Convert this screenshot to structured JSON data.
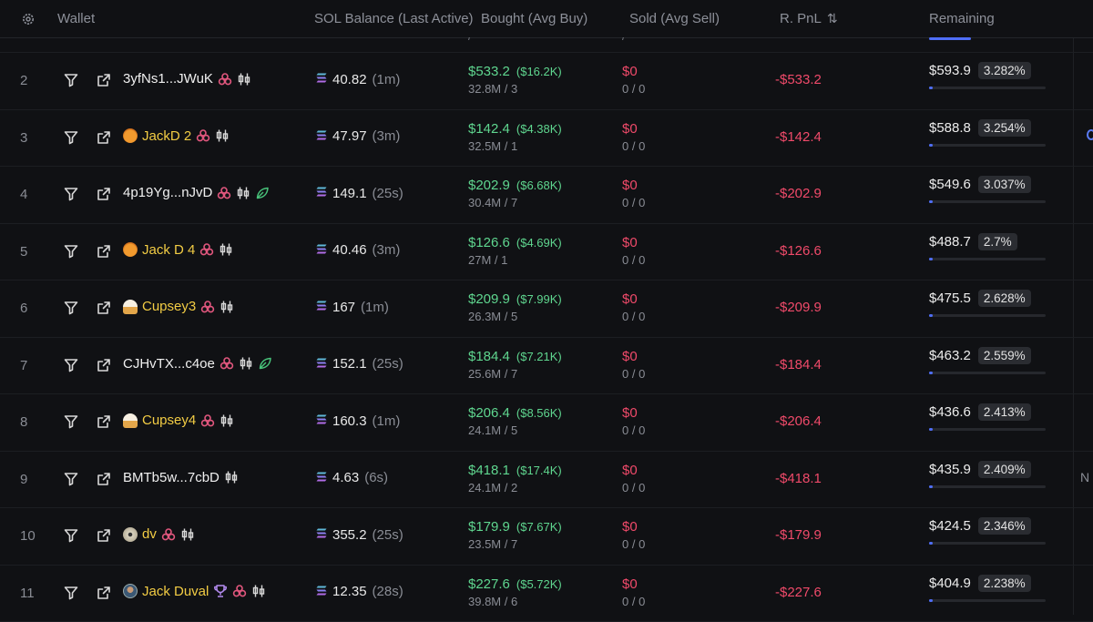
{
  "header": {
    "wallet": "Wallet",
    "sol_balance": "SOL Balance (Last Active)",
    "bought": "Bought (Avg Buy)",
    "sold": "Sold (Avg Sell)",
    "rpnl": "R. PnL",
    "remaining": "Remaining"
  },
  "peek": {
    "bought_sub": "/",
    "sold_sub": "/"
  },
  "colors": {
    "positive": "#5fd68f",
    "negative": "#f04a6a",
    "accent": "#4f6ef7",
    "gold_name": "#f2cc44"
  },
  "rows": [
    {
      "num": "2",
      "wallet": "3yfNs1...JWuK",
      "sol": "40.82",
      "sol_time": "(1m)",
      "bought": "$533.2",
      "bought_avg": "($16.2K)",
      "bought_sub": "32.8M / 3",
      "sold": "$0",
      "sold_sub": "0 / 0",
      "pnl": "-$533.2",
      "remaining": "$593.9",
      "remaining_pct": "3.282%",
      "edge": ""
    },
    {
      "num": "3",
      "wallet": "JackD 2",
      "sol": "47.97",
      "sol_time": "(3m)",
      "bought": "$142.4",
      "bought_avg": "($4.38K)",
      "bought_sub": "32.5M / 1",
      "sold": "$0",
      "sold_sub": "0 / 0",
      "pnl": "-$142.4",
      "remaining": "$588.8",
      "remaining_pct": "3.254%",
      "edge": ""
    },
    {
      "num": "4",
      "wallet": "4p19Yg...nJvD",
      "sol": "149.1",
      "sol_time": "(25s)",
      "bought": "$202.9",
      "bought_avg": "($6.68K)",
      "bought_sub": "30.4M / 7",
      "sold": "$0",
      "sold_sub": "0 / 0",
      "pnl": "-$202.9",
      "remaining": "$549.6",
      "remaining_pct": "3.037%",
      "edge": ""
    },
    {
      "num": "5",
      "wallet": "Jack D 4",
      "sol": "40.46",
      "sol_time": "(3m)",
      "bought": "$126.6",
      "bought_avg": "($4.69K)",
      "bought_sub": "27M / 1",
      "sold": "$0",
      "sold_sub": "0 / 0",
      "pnl": "-$126.6",
      "remaining": "$488.7",
      "remaining_pct": "2.7%",
      "edge": ""
    },
    {
      "num": "6",
      "wallet": "Cupsey3",
      "sol": "167",
      "sol_time": "(1m)",
      "bought": "$209.9",
      "bought_avg": "($7.99K)",
      "bought_sub": "26.3M / 5",
      "sold": "$0",
      "sold_sub": "0 / 0",
      "pnl": "-$209.9",
      "remaining": "$475.5",
      "remaining_pct": "2.628%",
      "edge": ""
    },
    {
      "num": "7",
      "wallet": "CJHvTX...c4oe",
      "sol": "152.1",
      "sol_time": "(25s)",
      "bought": "$184.4",
      "bought_avg": "($7.21K)",
      "bought_sub": "25.6M / 7",
      "sold": "$0",
      "sold_sub": "0 / 0",
      "pnl": "-$184.4",
      "remaining": "$463.2",
      "remaining_pct": "2.559%",
      "edge": ""
    },
    {
      "num": "8",
      "wallet": "Cupsey4",
      "sol": "160.3",
      "sol_time": "(1m)",
      "bought": "$206.4",
      "bought_avg": "($8.56K)",
      "bought_sub": "24.1M / 5",
      "sold": "$0",
      "sold_sub": "0 / 0",
      "pnl": "-$206.4",
      "remaining": "$436.6",
      "remaining_pct": "2.413%",
      "edge": ""
    },
    {
      "num": "9",
      "wallet": "BMTb5w...7cbD",
      "sol": "4.63",
      "sol_time": "(6s)",
      "bought": "$418.1",
      "bought_avg": "($17.4K)",
      "bought_sub": "24.1M / 2",
      "sold": "$0",
      "sold_sub": "0 / 0",
      "pnl": "-$418.1",
      "remaining": "$435.9",
      "remaining_pct": "2.409%",
      "edge": "N"
    },
    {
      "num": "10",
      "wallet": "dv",
      "sol": "355.2",
      "sol_time": "(25s)",
      "bought": "$179.9",
      "bought_avg": "($7.67K)",
      "bought_sub": "23.5M / 7",
      "sold": "$0",
      "sold_sub": "0 / 0",
      "pnl": "-$179.9",
      "remaining": "$424.5",
      "remaining_pct": "2.346%",
      "edge": ""
    },
    {
      "num": "11",
      "wallet": "Jack Duval",
      "sol": "12.35",
      "sol_time": "(28s)",
      "bought": "$227.6",
      "bought_avg": "($5.72K)",
      "bought_sub": "39.8M / 6",
      "sold": "$0",
      "sold_sub": "0 / 0",
      "pnl": "-$227.6",
      "remaining": "$404.9",
      "remaining_pct": "2.238%",
      "edge": ""
    }
  ]
}
